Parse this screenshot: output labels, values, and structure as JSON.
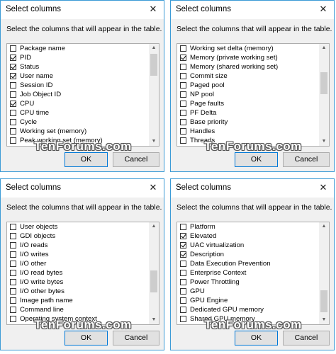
{
  "watermark": "TenForums.com",
  "dialogs": [
    {
      "title": "Select columns",
      "instruction": "Select the columns that will appear in the table.",
      "ok": "OK",
      "cancel": "Cancel",
      "items": [
        {
          "label": "Package name",
          "checked": false
        },
        {
          "label": "PID",
          "checked": true
        },
        {
          "label": "Status",
          "checked": true
        },
        {
          "label": "User name",
          "checked": true
        },
        {
          "label": "Session ID",
          "checked": false
        },
        {
          "label": "Job Object ID",
          "checked": false
        },
        {
          "label": "CPU",
          "checked": true
        },
        {
          "label": "CPU time",
          "checked": false
        },
        {
          "label": "Cycle",
          "checked": false
        },
        {
          "label": "Working set (memory)",
          "checked": false
        },
        {
          "label": "Peak working set (memory)",
          "checked": false
        }
      ]
    },
    {
      "title": "Select columns",
      "instruction": "Select the columns that will appear in the table.",
      "ok": "OK",
      "cancel": "Cancel",
      "items": [
        {
          "label": "Working set delta (memory)",
          "checked": false
        },
        {
          "label": "Memory (private working set)",
          "checked": true
        },
        {
          "label": "Memory (shared working set)",
          "checked": false
        },
        {
          "label": "Commit size",
          "checked": false
        },
        {
          "label": "Paged pool",
          "checked": false
        },
        {
          "label": "NP pool",
          "checked": false
        },
        {
          "label": "Page faults",
          "checked": false
        },
        {
          "label": "PF Delta",
          "checked": false
        },
        {
          "label": "Base priority",
          "checked": false
        },
        {
          "label": "Handles",
          "checked": false
        },
        {
          "label": "Threads",
          "checked": false
        }
      ]
    },
    {
      "title": "Select columns",
      "instruction": "Select the columns that will appear in the table.",
      "ok": "OK",
      "cancel": "Cancel",
      "items": [
        {
          "label": "User objects",
          "checked": false
        },
        {
          "label": "GDI objects",
          "checked": false
        },
        {
          "label": "I/O reads",
          "checked": false
        },
        {
          "label": "I/O writes",
          "checked": false
        },
        {
          "label": "I/O other",
          "checked": false
        },
        {
          "label": "I/O read bytes",
          "checked": false
        },
        {
          "label": "I/O write bytes",
          "checked": false
        },
        {
          "label": "I/O other bytes",
          "checked": false
        },
        {
          "label": "Image path name",
          "checked": false
        },
        {
          "label": "Command line",
          "checked": false
        },
        {
          "label": "Operating system context",
          "checked": false
        }
      ]
    },
    {
      "title": "Select columns",
      "instruction": "Select the columns that will appear in the table.",
      "ok": "OK",
      "cancel": "Cancel",
      "items": [
        {
          "label": "Platform",
          "checked": false
        },
        {
          "label": "Elevated",
          "checked": true
        },
        {
          "label": "UAC virtualization",
          "checked": true
        },
        {
          "label": "Description",
          "checked": true
        },
        {
          "label": "Data Execution Prevention",
          "checked": false
        },
        {
          "label": "Enterprise Context",
          "checked": false
        },
        {
          "label": "Power Throttling",
          "checked": false
        },
        {
          "label": "GPU",
          "checked": false
        },
        {
          "label": "GPU Engine",
          "checked": false
        },
        {
          "label": "Dedicated GPU memory",
          "checked": false
        },
        {
          "label": "Shared GPU memory",
          "checked": false
        }
      ]
    }
  ]
}
